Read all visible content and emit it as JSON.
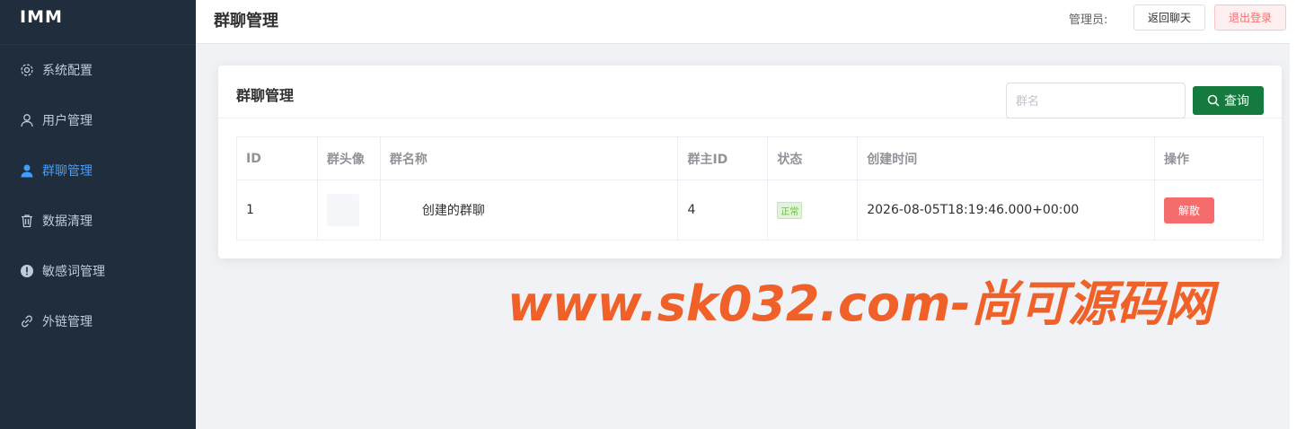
{
  "app": {
    "logo": "IMM"
  },
  "sidebar": {
    "items": [
      {
        "label": "系统配置",
        "icon": "gear-icon"
      },
      {
        "label": "用户管理",
        "icon": "user-outline-icon"
      },
      {
        "label": "群聊管理",
        "icon": "user-filled-icon",
        "active": true
      },
      {
        "label": "数据清理",
        "icon": "trash-icon"
      },
      {
        "label": "敏感词管理",
        "icon": "warning-icon"
      },
      {
        "label": "外链管理",
        "icon": "link-icon"
      }
    ]
  },
  "header": {
    "title": "群聊管理",
    "admin_label": "管理员:",
    "back_label": "返回聊天",
    "logout_label": "退出登录"
  },
  "card": {
    "title": "群聊管理",
    "search_placeholder": "群名",
    "query_label": "查询"
  },
  "table": {
    "columns": [
      "ID",
      "群头像",
      "群名称",
      "群主ID",
      "状态",
      "创建时间",
      "操作"
    ],
    "rows": [
      {
        "id": "1",
        "name": "创建的群聊",
        "owner_id": "4",
        "status": "正常",
        "created": "2026-08-05T18:19:46.000+00:00",
        "action": "解散"
      }
    ]
  },
  "watermark": "www.sk032.com-尚可源码网",
  "colors": {
    "sidebar": "#1f2d3d",
    "active": "#409eff",
    "primary": "#157a3e",
    "danger": "#f56c6c",
    "watermark": "#f0612a"
  }
}
